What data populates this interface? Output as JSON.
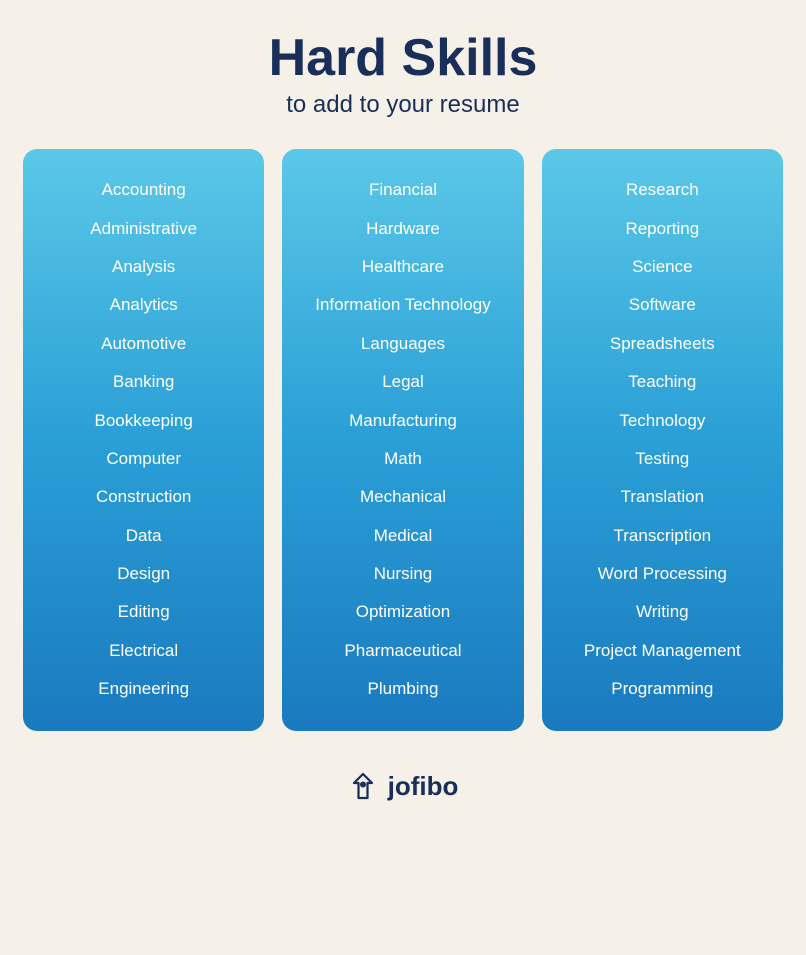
{
  "header": {
    "title": "Hard Skills",
    "subtitle": "to add to your resume"
  },
  "columns": [
    {
      "id": "col1",
      "skills": [
        "Accounting",
        "Administrative",
        "Analysis",
        "Analytics",
        "Automotive",
        "Banking",
        "Bookkeeping",
        "Computer",
        "Construction",
        "Data",
        "Design",
        "Editing",
        "Electrical",
        "Engineering"
      ]
    },
    {
      "id": "col2",
      "skills": [
        "Financial",
        "Hardware",
        "Healthcare",
        "Information Technology",
        "Languages",
        "Legal",
        "Manufacturing",
        "Math",
        "Mechanical",
        "Medical",
        "Nursing",
        "Optimization",
        "Pharmaceutical",
        "Plumbing"
      ]
    },
    {
      "id": "col3",
      "skills": [
        "Research",
        "Reporting",
        "Science",
        "Software",
        "Spreadsheets",
        "Teaching",
        "Technology",
        "Testing",
        "Translation",
        "Transcription",
        "Word Processing",
        "Writing",
        "Project Management",
        "Programming"
      ]
    }
  ],
  "footer": {
    "brand": "jofibo"
  }
}
